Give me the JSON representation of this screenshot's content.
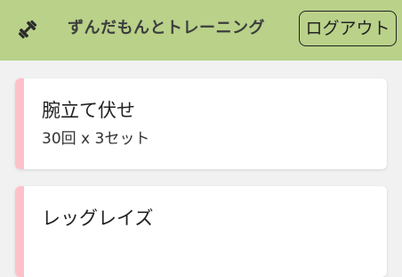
{
  "header": {
    "logo_icon": "dumbbell-icon",
    "title": "ずんだもんとトレーニング",
    "logout_label": "ログアウト",
    "background": "#b9d189"
  },
  "exercises": [
    {
      "name": "腕立て伏せ",
      "detail": "30回 x 3セット"
    },
    {
      "name": "レッグレイズ",
      "detail": ""
    }
  ],
  "accent_color": "#ffc1c9"
}
